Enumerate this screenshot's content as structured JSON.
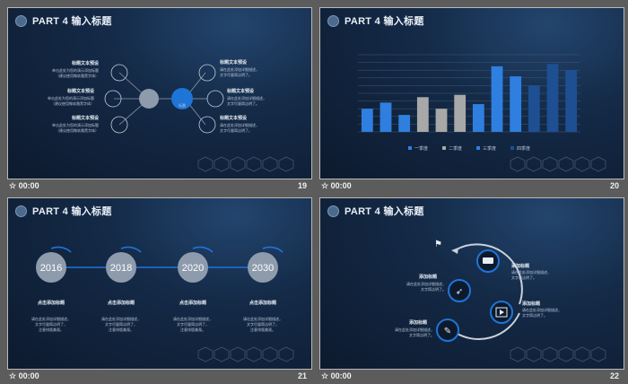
{
  "colors": {
    "accent": "#2e7fe0",
    "navy": "#142a47",
    "gray_bar": "#a8a8a8",
    "dark_bar": "#1d4f92"
  },
  "footer_time": "00:00",
  "slides": [
    {
      "title": "PART 4 输入标题",
      "page": "19",
      "center_label": "标题",
      "left_items": [
        {
          "title": "标题文本预设",
          "desc": [
            "单击此处为您的演示添加标题",
            "（建议使用微软雅黑字体）"
          ]
        },
        {
          "title": "标题文本预设",
          "desc": [
            "单击此处为您的演示添加标题",
            "（建议使用微软雅黑字体）"
          ]
        },
        {
          "title": "标题文本预设",
          "desc": [
            "单击此处为您的演示添加标题",
            "（建议使用微软雅黑字体）"
          ]
        }
      ],
      "right_items": [
        {
          "title": "标题文本预设",
          "desc": [
            "请在此处添加详细描述，",
            "文字尽量简洁明了。"
          ]
        },
        {
          "title": "标题文本预设",
          "desc": [
            "请在此处添加详细描述，",
            "文字尽量简洁明了。"
          ]
        },
        {
          "title": "标题文本预设",
          "desc": [
            "请在此处添加详细描述，",
            "文字尽量简洁明了。"
          ]
        }
      ]
    },
    {
      "title": "PART 4 输入标题",
      "page": "20",
      "legend": [
        "一季度",
        "二季度",
        "三季度",
        "四季度"
      ]
    },
    {
      "title": "PART 4 输入标题",
      "page": "21",
      "years": [
        "2016",
        "2018",
        "2020",
        "2030"
      ],
      "item_title": "点击添加标题",
      "item_desc": [
        "请在此处添加详细描述，",
        "文字尽量简洁明了，",
        "注意排版美观。"
      ]
    },
    {
      "title": "PART 4 输入标题",
      "page": "22",
      "blocks": [
        {
          "title": "添加标题",
          "desc": [
            "请在此处添加详细描述，",
            "文字简洁明了。"
          ]
        },
        {
          "title": "添加标题",
          "desc": [
            "请在此处添加详细描述，",
            "文字简洁明了。"
          ]
        },
        {
          "title": "添加标题",
          "desc": [
            "请在此处添加详细描述，",
            "文字简洁明了。"
          ]
        },
        {
          "title": "添加标题",
          "desc": [
            "请在此处添加详细描述，",
            "文字简洁明了。"
          ]
        }
      ]
    }
  ],
  "chart_data": {
    "type": "bar",
    "categories": [
      "",
      "",
      "",
      "",
      "",
      "",
      "",
      "",
      "",
      "",
      "",
      ""
    ],
    "values": [
      30,
      38,
      22,
      45,
      30,
      48,
      36,
      85,
      72,
      60,
      88,
      80
    ],
    "bar_colors": [
      "#2e7fe0",
      "#2e7fe0",
      "#2e7fe0",
      "#a8a8a8",
      "#a8a8a8",
      "#a8a8a8",
      "#2e7fe0",
      "#2e7fe0",
      "#2e7fe0",
      "#1d4f92",
      "#1d4f92",
      "#1d4f92"
    ],
    "data_labels": [
      "",
      "",
      "",
      "",
      "",
      "",
      "",
      "",
      "",
      "",
      "",
      ""
    ],
    "ylim": [
      0,
      100
    ],
    "grid": true,
    "legend_position": "bottom"
  }
}
